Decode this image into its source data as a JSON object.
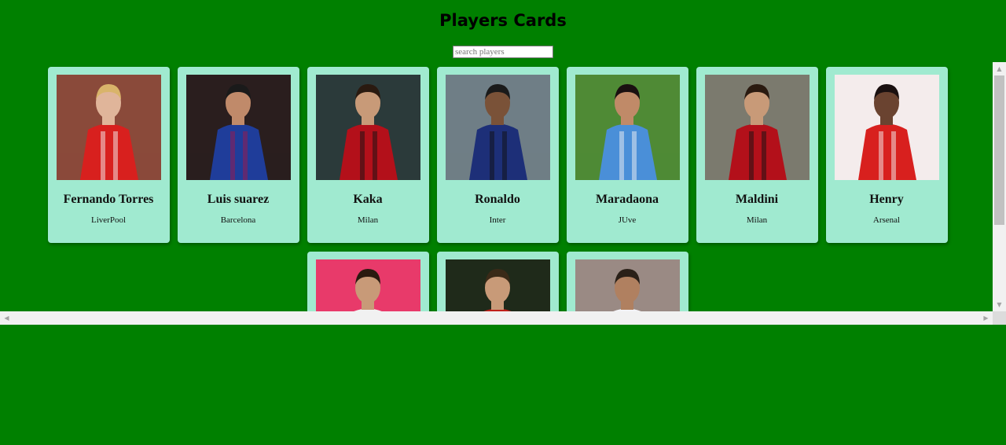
{
  "page": {
    "title": "Players Cards"
  },
  "search": {
    "placeholder": "search players",
    "value": ""
  },
  "players": [
    {
      "name": "Fernando Torres",
      "club": "LiverPool",
      "photo_icon": "player-photo-icon",
      "colors": {
        "bg": "#8a4a3a",
        "kit": "#d8201e",
        "skin": "#e0b59a",
        "hair": "#d9b46a",
        "accent": "#f2f2f2"
      }
    },
    {
      "name": "Luis suarez",
      "club": "Barcelona",
      "photo_icon": "player-photo-icon",
      "colors": {
        "bg": "#2a1e1e",
        "kit": "#1f3d9a",
        "skin": "#c08a6a",
        "hair": "#1a1a1a",
        "accent": "#a0174a"
      }
    },
    {
      "name": "Kaka",
      "club": "Milan",
      "photo_icon": "player-photo-icon",
      "colors": {
        "bg": "#2b3a3a",
        "kit": "#b3101a",
        "skin": "#c89a78",
        "hair": "#2a1a10",
        "accent": "#111111"
      }
    },
    {
      "name": "Ronaldo",
      "club": "Inter",
      "photo_icon": "player-photo-icon",
      "colors": {
        "bg": "#6f7e86",
        "kit": "#1d2f78",
        "skin": "#7a5238",
        "hair": "#1a1a1a",
        "accent": "#101010"
      }
    },
    {
      "name": "Maradaona",
      "club": "JUve",
      "photo_icon": "player-photo-icon",
      "colors": {
        "bg": "#4f8a35",
        "kit": "#4a8fd8",
        "skin": "#c08a68",
        "hair": "#1a1010",
        "accent": "#f2f2f2"
      }
    },
    {
      "name": "Maldini",
      "club": "Milan",
      "photo_icon": "player-photo-icon",
      "colors": {
        "bg": "#7b7a6e",
        "kit": "#b3101a",
        "skin": "#c89a78",
        "hair": "#2a1a10",
        "accent": "#111111"
      }
    },
    {
      "name": "Henry",
      "club": "Arsenal",
      "photo_icon": "player-photo-icon",
      "colors": {
        "bg": "#f4ecec",
        "kit": "#d8201e",
        "skin": "#6a4330",
        "hair": "#1a1010",
        "accent": "#f2f2f2"
      }
    },
    {
      "name": "",
      "club": "",
      "photo_icon": "player-photo-icon",
      "colors": {
        "bg": "#e83a6a",
        "kit": "#f2f2f2",
        "skin": "#c89a78",
        "hair": "#2a1a10",
        "accent": "#3a8a3a"
      }
    },
    {
      "name": "",
      "club": "",
      "photo_icon": "player-photo-icon",
      "colors": {
        "bg": "#1f2a1a",
        "kit": "#c0201a",
        "skin": "#c89a78",
        "hair": "#3a2a18",
        "accent": "#3a7a30"
      }
    },
    {
      "name": "",
      "club": "",
      "photo_icon": "player-photo-icon",
      "colors": {
        "bg": "#9a8a84",
        "kit": "#f4f4f8",
        "skin": "#b08060",
        "hair": "#2a2018",
        "accent": "#2a2a5a"
      }
    }
  ],
  "scrollbars": {
    "vertical": {
      "up_icon": "scroll-up-arrow-icon",
      "down_icon": "scroll-down-arrow-icon"
    },
    "horizontal": {
      "left_icon": "scroll-left-arrow-icon",
      "right_icon": "scroll-right-arrow-icon"
    }
  }
}
